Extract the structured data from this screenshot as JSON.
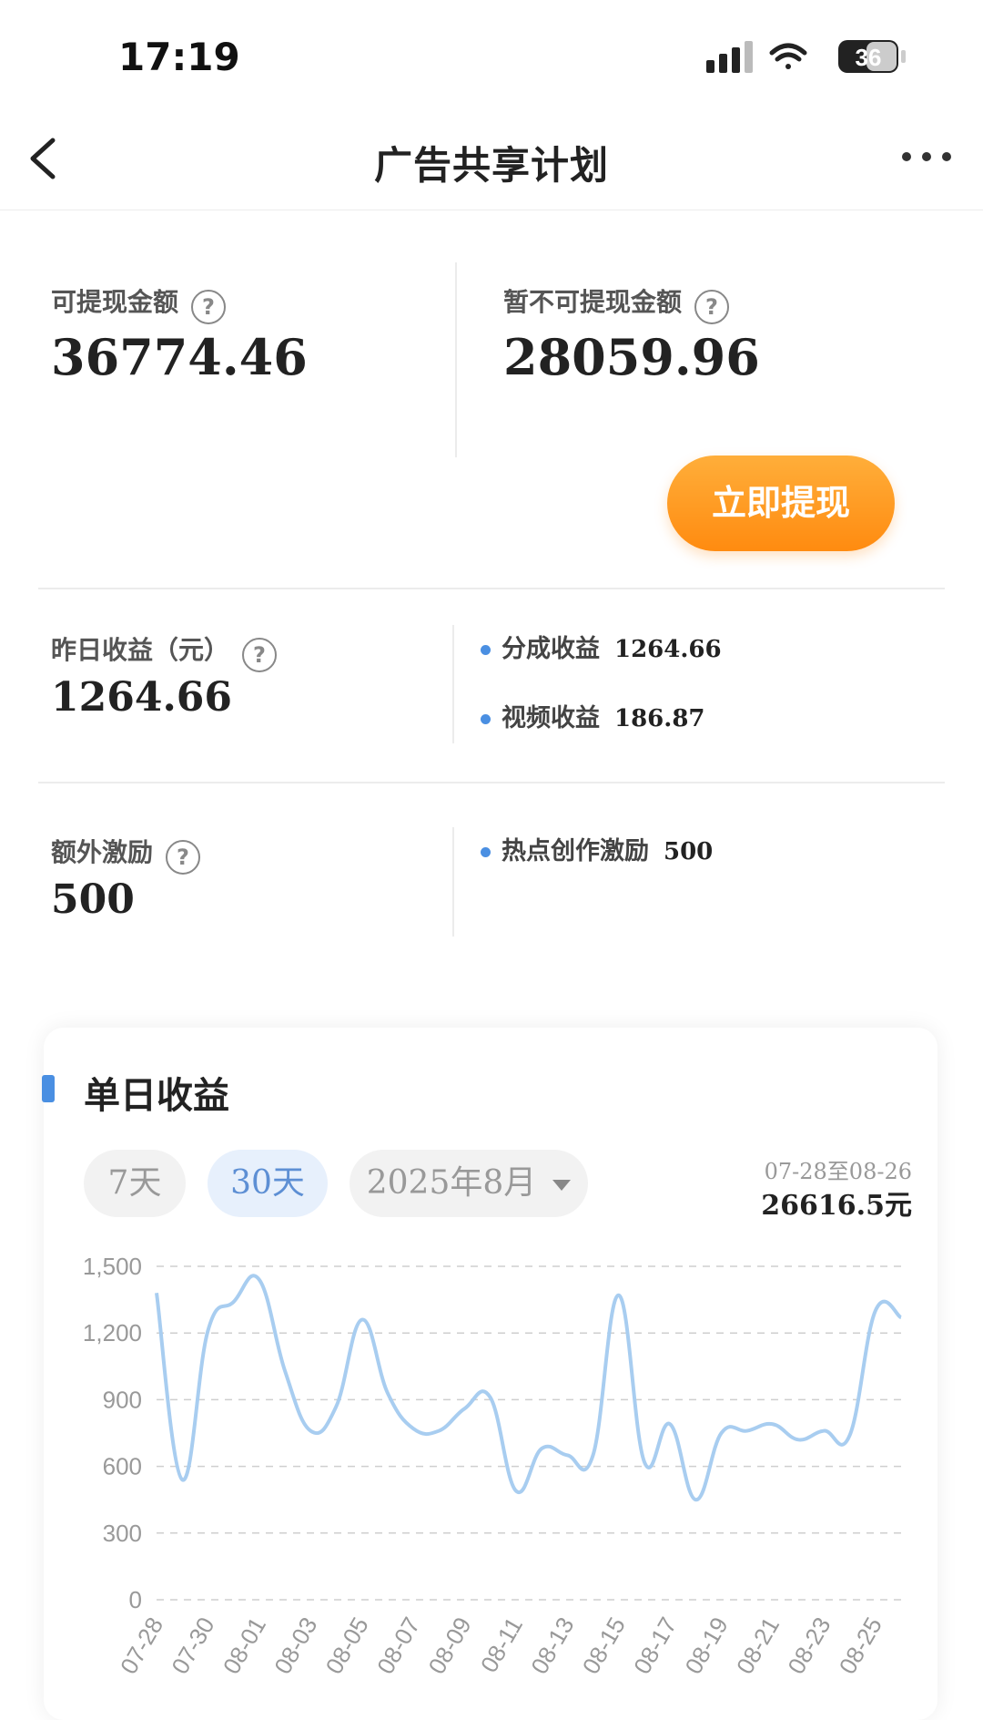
{
  "status_bar": {
    "time": "17:19",
    "battery": "36"
  },
  "nav": {
    "title": "广告共享计划"
  },
  "balances": {
    "withdrawable_label": "可提现金额",
    "withdrawable_value": "36774.46",
    "pending_label": "暂不可提现金额",
    "pending_value": "28059.96",
    "withdraw_button": "立即提现"
  },
  "yesterday": {
    "label": "昨日收益（元）",
    "value": "1264.66",
    "items": [
      {
        "label": "分成收益",
        "value": "1264.66"
      },
      {
        "label": "视频收益",
        "value": "186.87"
      }
    ]
  },
  "extra": {
    "label": "额外激励",
    "value": "500",
    "items": [
      {
        "label": "热点创作激励",
        "value": "500"
      }
    ]
  },
  "daily_card": {
    "title": "单日收益",
    "tabs": [
      "7天",
      "30天"
    ],
    "active_tab": "30天",
    "month_select": "2025年8月",
    "date_range": "07-28至08-26",
    "total": "26616.5元"
  },
  "chart_data": {
    "type": "line",
    "ylim": [
      0,
      1500
    ],
    "yticks": [
      "0",
      "300",
      "600",
      "900",
      "1,200",
      "1,500"
    ],
    "xtick_labels": [
      "07-28",
      "07-30",
      "08-01",
      "08-03",
      "08-05",
      "08-07",
      "08-09",
      "08-11",
      "08-13",
      "08-15",
      "08-17",
      "08-19",
      "08-21",
      "08-23",
      "08-25"
    ],
    "x": [
      "07-28",
      "07-29",
      "07-30",
      "07-31",
      "08-01",
      "08-02",
      "08-03",
      "08-04",
      "08-05",
      "08-06",
      "08-07",
      "08-08",
      "08-09",
      "08-10",
      "08-11",
      "08-12",
      "08-13",
      "08-14",
      "08-15",
      "08-16",
      "08-17",
      "08-18",
      "08-19",
      "08-20",
      "08-21",
      "08-22",
      "08-23",
      "08-24",
      "08-25",
      "08-26"
    ],
    "values": [
      1380,
      540,
      1210,
      1340,
      1440,
      1030,
      760,
      870,
      1260,
      930,
      770,
      760,
      860,
      910,
      490,
      680,
      650,
      650,
      1370,
      620,
      790,
      450,
      750,
      760,
      790,
      720,
      760,
      740,
      1300,
      1270
    ],
    "line_color": "#a8cdf0",
    "grid": "dashed-horizontal"
  }
}
